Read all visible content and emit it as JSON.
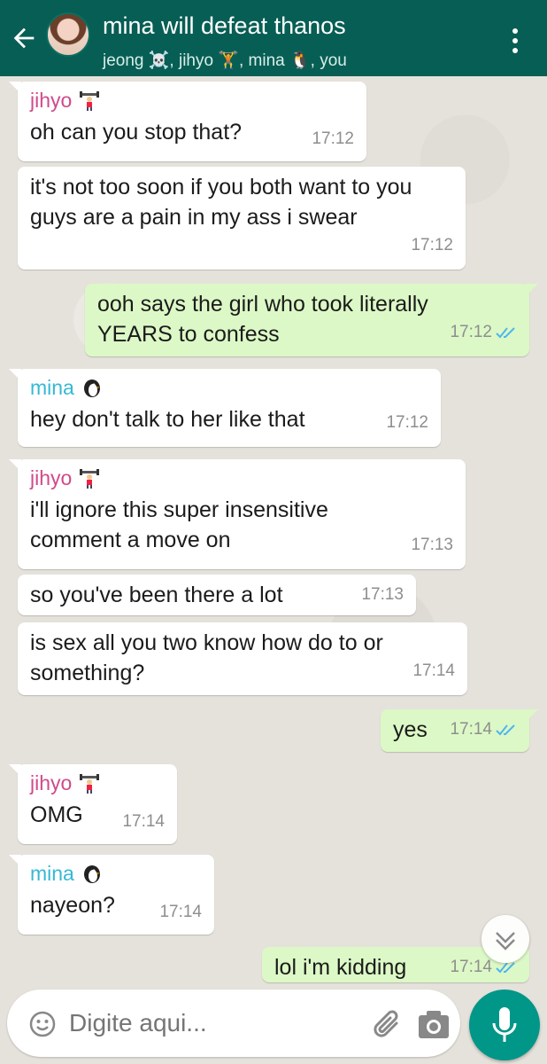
{
  "header": {
    "title": "mina will defeat thanos",
    "subtitle": "jeong ☠️, jihyo 🏋️, mina 🐧, you"
  },
  "messages": [
    {
      "sender": "jihyo",
      "text": "oh can you stop that?",
      "time": "17:12"
    },
    {
      "text": "it's not too soon if you both want to you guys are a pain in my ass i swear",
      "time": "17:12"
    },
    {
      "text": "ooh says the girl who took literally YEARS to confess",
      "time": "17:12"
    },
    {
      "sender": "mina",
      "text": "hey don't talk to her like that",
      "time": "17:12"
    },
    {
      "sender": "jihyo",
      "text": "i'll ignore this super insensitive comment a move on",
      "time": "17:13"
    },
    {
      "text": "so you've been there a lot",
      "time": "17:13"
    },
    {
      "text": "is sex all you two know how do to or something?",
      "time": "17:14"
    },
    {
      "text": "yes",
      "time": "17:14"
    },
    {
      "sender": "jihyo",
      "text": "OMG",
      "time": "17:14"
    },
    {
      "sender": "mina",
      "text": "nayeon?",
      "time": "17:14"
    },
    {
      "text": "lol i'm kidding",
      "time": "17:14"
    }
  ],
  "input": {
    "placeholder": "Digite aqui..."
  },
  "colors": {
    "header": "#075e54",
    "incoming": "#ffffff",
    "outgoing": "#dcf8c6",
    "jihyo_name": "#d04a8a",
    "mina_name": "#35b8d6",
    "read_ticks": "#4fb6ec",
    "mic": "#009688"
  },
  "icons": {
    "back": "arrow-left-icon",
    "menu": "kebab-menu-icon",
    "emoji": "smiley-icon",
    "attach": "paperclip-icon",
    "camera": "camera-icon",
    "mic": "microphone-icon",
    "scroll": "chevron-down-icon"
  }
}
